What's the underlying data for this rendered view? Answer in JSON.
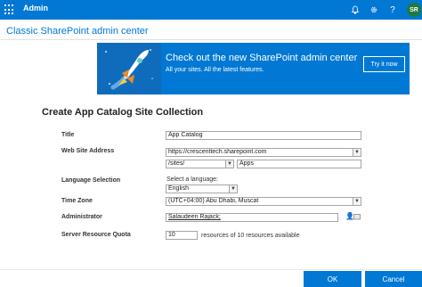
{
  "topbar": {
    "app_name": "Admin",
    "waffle_icon": "waffle-icon",
    "icons": [
      "bell-icon",
      "gear-icon",
      "help-icon"
    ],
    "avatar_initials": "SR",
    "color": "#0078d4"
  },
  "page": {
    "title": "Classic SharePoint admin center"
  },
  "banner": {
    "title": "Check out the new SharePoint admin center",
    "subtitle": "All your sites. All the latest features.",
    "button_label": "Try it now",
    "color": "#0078d4"
  },
  "form": {
    "heading": "Create App Catalog Site Collection",
    "title_label": "Title",
    "title_value": "App Catalog",
    "address_label": "Web Site Address",
    "address_domain": "https://crescenttech.sharepoint.com",
    "address_path": "/sites/",
    "address_name": "Apps",
    "language_label": "Language Selection",
    "language_hint": "Select a language:",
    "language_value": "English",
    "timezone_label": "Time Zone",
    "timezone_value": "(UTC+04:00) Abu Dhabi, Muscat",
    "admin_label": "Administrator",
    "admin_value": "Salaudeen Rajack;",
    "quota_label": "Server Resource Quota",
    "quota_value": "10",
    "quota_suffix": "resources of 10 resources available"
  },
  "footer": {
    "ok_label": "OK",
    "cancel_label": "Cancel"
  }
}
